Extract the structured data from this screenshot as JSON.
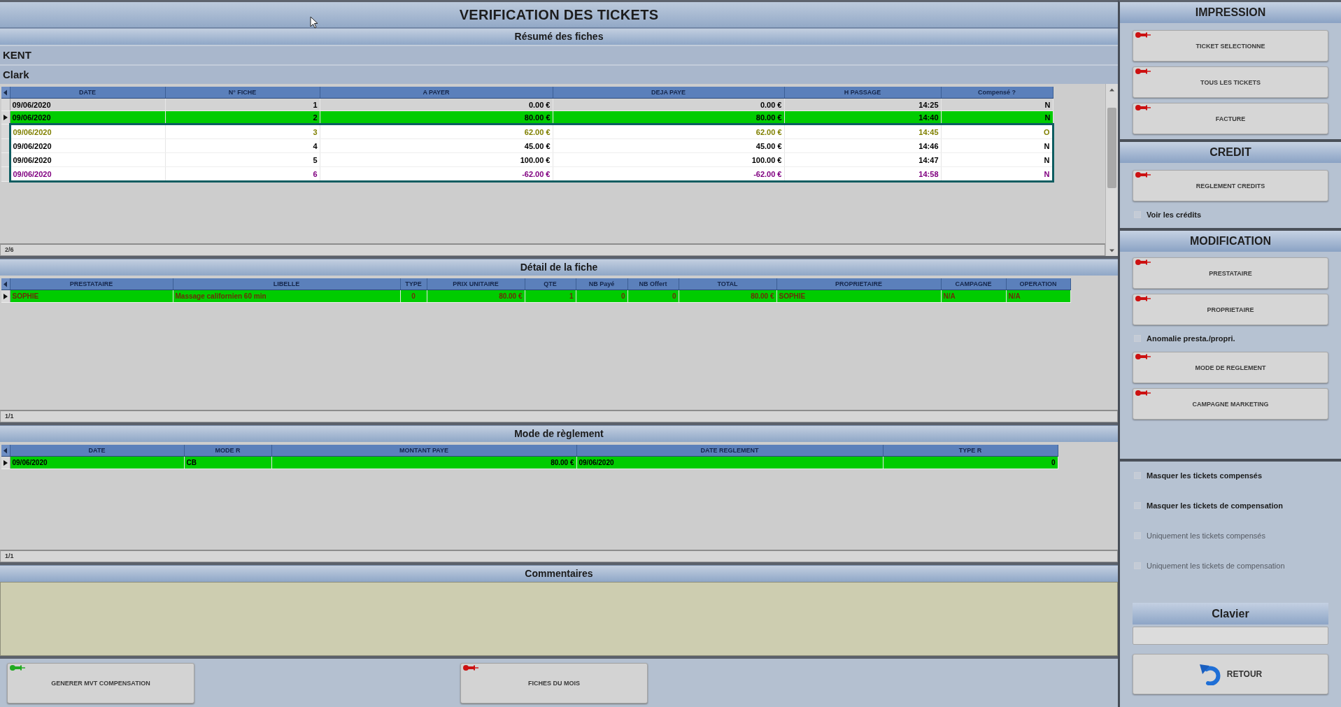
{
  "window": {
    "title": "VERIFICATION DES TICKETS"
  },
  "summary": {
    "title": "Résumé des fiches",
    "client": {
      "last_name": "KENT",
      "first_name": "Clark"
    },
    "table": {
      "columns": [
        "DATE",
        "N° FICHE",
        "A PAYER",
        "DEJA PAYE",
        "H PASSAGE",
        "Compensé ?"
      ],
      "rows": [
        {
          "cells": [
            "09/06/2020",
            "1",
            "0.00 €",
            "0.00 €",
            "14:25",
            "N"
          ],
          "selected": false,
          "highlighted": false
        },
        {
          "cells": [
            "09/06/2020",
            "2",
            "80.00 €",
            "80.00 €",
            "14:40",
            "N"
          ],
          "selected": true,
          "highlighted": false
        },
        {
          "cells": [
            "09/06/2020",
            "3",
            "62.00 €",
            "62.00 €",
            "14:45",
            "O"
          ],
          "selected": false,
          "highlighted": true,
          "color": "#808000"
        },
        {
          "cells": [
            "09/06/2020",
            "4",
            "45.00 €",
            "45.00 €",
            "14:46",
            "N"
          ],
          "selected": false,
          "highlighted": true
        },
        {
          "cells": [
            "09/06/2020",
            "5",
            "100.00 €",
            "100.00 €",
            "14:47",
            "N"
          ],
          "selected": false,
          "highlighted": true
        },
        {
          "cells": [
            "09/06/2020",
            "6",
            "-62.00 €",
            "-62.00 €",
            "14:58",
            "N"
          ],
          "selected": false,
          "highlighted": true,
          "color": "#800080"
        }
      ],
      "record_count": "2/6"
    }
  },
  "detail": {
    "title": "Détail de la fiche",
    "table": {
      "columns": [
        "PRESTATAIRE",
        "LIBELLE",
        "TYPE",
        "PRIX UNITAIRE",
        "QTE",
        "NB Payé",
        "NB Offert",
        "TOTAL",
        "PROPRIETAIRE",
        "CAMPAGNE",
        "OPERATION"
      ],
      "rows": [
        {
          "cells": [
            "SOPHIE",
            "Massage californien 60 min",
            "0",
            "80.00 €",
            "1",
            "0",
            "0",
            "80.00 €",
            "SOPHIE",
            "N/A",
            "N/A"
          ],
          "selected": true
        }
      ],
      "record_count": "1/1"
    }
  },
  "payment": {
    "title": "Mode de règlement",
    "table": {
      "columns": [
        "DATE",
        "MODE R",
        "MONTANT PAYE",
        "DATE REGLEMENT",
        "TYPE R"
      ],
      "rows": [
        {
          "cells": [
            "09/06/2020",
            "CB",
            "80.00 €",
            "09/06/2020",
            "0"
          ],
          "selected": true
        }
      ],
      "record_count": "1/1"
    }
  },
  "comments": {
    "title": "Commentaires"
  },
  "bottom_buttons": [
    {
      "label": "GENERER MVT COMPENSATION",
      "color": "#22aa22"
    },
    {
      "label": "FICHES DU MOIS",
      "color": "#cc1111"
    }
  ],
  "side_panel": {
    "sections": [
      {
        "title": "IMPRESSION",
        "items": [
          {
            "kind": "button",
            "label": "TICKET SELECTIONNE"
          },
          {
            "kind": "button",
            "label": "TOUS LES TICKETS"
          },
          {
            "kind": "button",
            "label": "FACTURE"
          }
        ]
      },
      {
        "title": "CREDIT",
        "items": [
          {
            "kind": "button",
            "label": "REGLEMENT CREDITS"
          },
          {
            "kind": "checkbox",
            "label": "Voir les crédits",
            "checked": false
          }
        ]
      },
      {
        "title": "MODIFICATION",
        "items": [
          {
            "kind": "button",
            "label": "PRESTATAIRE"
          },
          {
            "kind": "button",
            "label": "PROPRIETAIRE"
          },
          {
            "kind": "checkbox",
            "label": "Anomalie presta./propri.",
            "checked": false
          },
          {
            "kind": "button",
            "label": "MODE DE REGLEMENT"
          },
          {
            "kind": "button",
            "label": "CAMPAGNE MARKETING"
          }
        ]
      }
    ],
    "filters": [
      {
        "label": "Masquer les tickets compensés",
        "checked": false,
        "disabled": false
      },
      {
        "label": "Masquer les tickets de compensation",
        "checked": false,
        "disabled": false
      },
      {
        "label": "Uniquement les tickets compensés",
        "checked": false,
        "disabled": true
      },
      {
        "label": "Uniquement les tickets de compensation",
        "checked": false,
        "disabled": true
      }
    ],
    "keyboard": {
      "title": "Clavier"
    },
    "back_button": {
      "label": "RETOUR"
    }
  }
}
